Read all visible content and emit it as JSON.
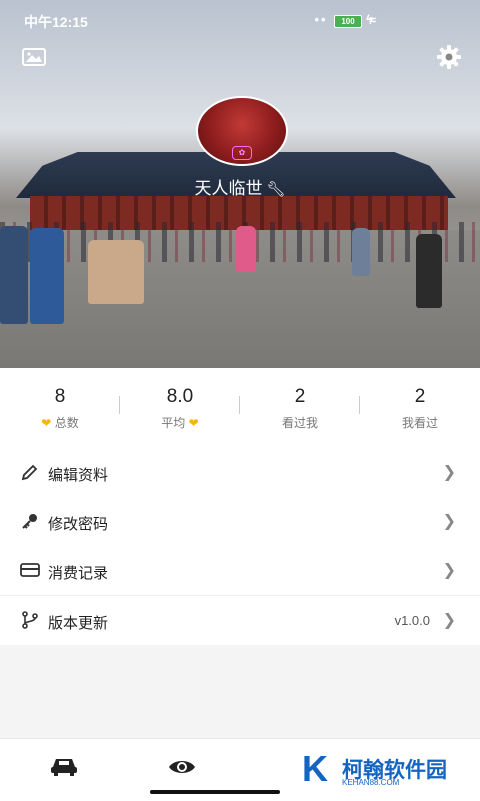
{
  "status_bar": {
    "time": "中午12:15",
    "icons": "•• ☺ ▮ ≈",
    "battery": "100"
  },
  "profile": {
    "nickname": "天人临世"
  },
  "stats": [
    {
      "value": "8",
      "label": "总数",
      "heart_before": true,
      "heart_after": false
    },
    {
      "value": "8.0",
      "label": "平均",
      "heart_before": false,
      "heart_after": true
    },
    {
      "value": "2",
      "label": "看过我",
      "heart_before": false,
      "heart_after": false
    },
    {
      "value": "2",
      "label": "我看过",
      "heart_before": false,
      "heart_after": false
    }
  ],
  "menu": {
    "edit_profile": "编辑资料",
    "change_password": "修改密码",
    "purchase_history": "消费记录",
    "version_update": "版本更新",
    "version": "v1.0.0"
  },
  "watermark": {
    "title": "柯翰软件园",
    "subtitle": "KEHAN88.COM",
    "letter": "K"
  },
  "colors": {
    "accent": "#f5b800",
    "brand": "#1565c0"
  }
}
